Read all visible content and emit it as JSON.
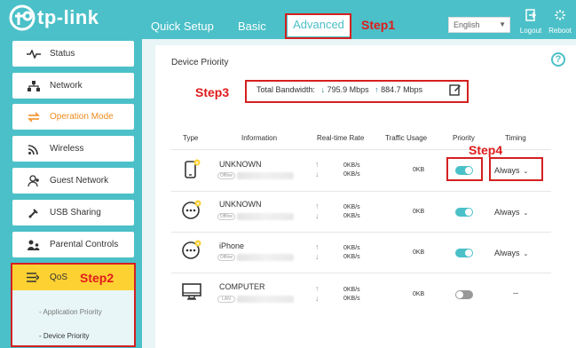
{
  "brand": {
    "name": "tp-link"
  },
  "nav": {
    "tabs": [
      {
        "label": "Quick Setup"
      },
      {
        "label": "Basic"
      },
      {
        "label": "Advanced",
        "active": true
      }
    ],
    "language": "English",
    "logout_label": "Logout",
    "reboot_label": "Reboot"
  },
  "sidebar": {
    "items": [
      {
        "label": "Status",
        "icon": "pulse-icon"
      },
      {
        "label": "Network",
        "icon": "network-icon"
      },
      {
        "label": "Operation Mode",
        "icon": "swap-icon",
        "highlight": true
      },
      {
        "label": "Wireless",
        "icon": "wifi-icon"
      },
      {
        "label": "Guest Network",
        "icon": "guest-users-icon"
      },
      {
        "label": "USB Sharing",
        "icon": "usb-icon"
      },
      {
        "label": "Parental Controls",
        "icon": "parental-icon"
      }
    ],
    "qos": {
      "label": "QoS",
      "icon": "qos-lines-icon",
      "sub_items": [
        {
          "label": "- Application Priority"
        },
        {
          "label": "- Device Priority",
          "active": true
        }
      ]
    }
  },
  "main": {
    "title": "Device Priority",
    "bandwidth_label": "Total Bandwidth:",
    "download": "795.9 Mbps",
    "upload": "884.7 Mbps",
    "columns": [
      "Type",
      "Information",
      "Real-time Rate",
      "Traffic Usage",
      "Priority",
      "Timing"
    ],
    "devices": [
      {
        "type_icon": "phone-icon",
        "name": "UNKNOWN",
        "status": "Offline",
        "up_rate": "0KB/s",
        "down_rate": "0KB/s",
        "traffic": "0KB",
        "priority": true,
        "timing": "Always"
      },
      {
        "type_icon": "dots-device-icon",
        "name": "UNKNOWN",
        "status": "Offline",
        "up_rate": "0KB/s",
        "down_rate": "0KB/s",
        "traffic": "0KB",
        "priority": true,
        "timing": "Always"
      },
      {
        "type_icon": "dots-device-icon",
        "name": "iPhone",
        "status": "Offline",
        "up_rate": "0KB/s",
        "down_rate": "0KB/s",
        "traffic": "0KB",
        "priority": true,
        "timing": "Always"
      },
      {
        "type_icon": "monitor-icon",
        "name": "COMPUTER",
        "status": "LAN",
        "up_rate": "0KB/s",
        "down_rate": "0KB/s",
        "traffic": "0KB",
        "priority": false,
        "timing": "--"
      }
    ]
  },
  "annotations": {
    "step1": "Step1",
    "step2": "Step2",
    "step3": "Step3",
    "step4": "Step4",
    "color": "#d42020"
  }
}
